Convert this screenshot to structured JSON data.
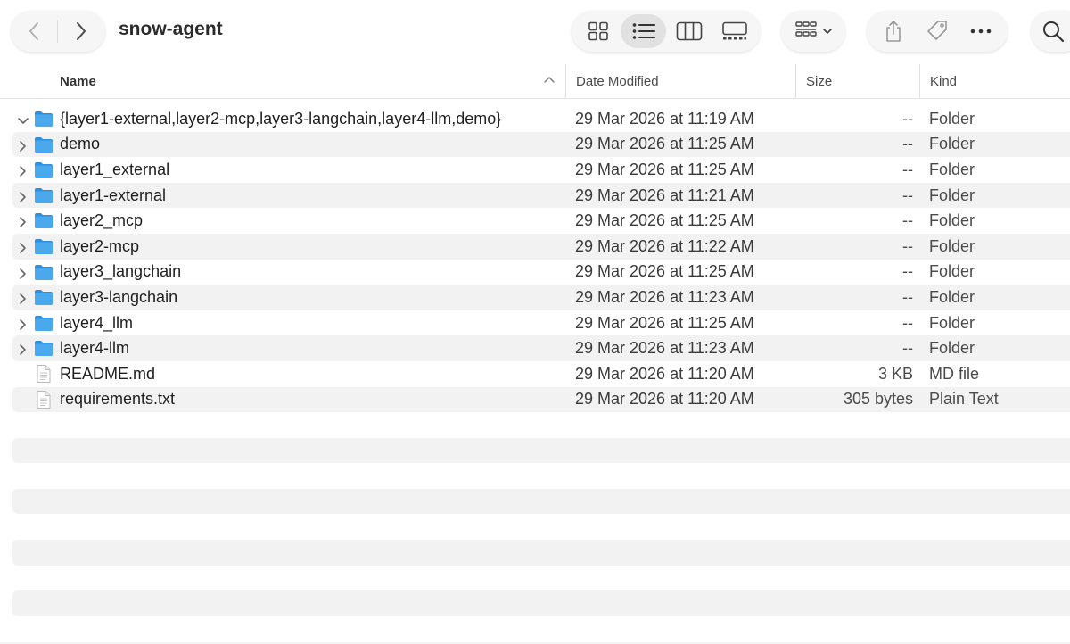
{
  "window": {
    "title": "snow-agent"
  },
  "toolbar": {
    "back_icon": "chevron-left-icon",
    "forward_icon": "chevron-right-icon",
    "view_modes": [
      "icon-view",
      "list-view",
      "column-view",
      "gallery-view"
    ],
    "active_view": "list-view"
  },
  "columns": {
    "name": "Name",
    "date": "Date Modified",
    "size": "Size",
    "kind": "Kind"
  },
  "files": [
    {
      "name": "{layer1-external,layer2-mcp,layer3-langchain,layer4-llm,demo}",
      "date": "29 Mar 2026 at 11:19 AM",
      "size": "--",
      "kind": "Folder",
      "type": "folder",
      "expanded": true
    },
    {
      "name": "demo",
      "date": "29 Mar 2026 at 11:25 AM",
      "size": "--",
      "kind": "Folder",
      "type": "folder",
      "expanded": false
    },
    {
      "name": "layer1_external",
      "date": "29 Mar 2026 at 11:25 AM",
      "size": "--",
      "kind": "Folder",
      "type": "folder",
      "expanded": false
    },
    {
      "name": "layer1-external",
      "date": "29 Mar 2026 at 11:21 AM",
      "size": "--",
      "kind": "Folder",
      "type": "folder",
      "expanded": false
    },
    {
      "name": "layer2_mcp",
      "date": "29 Mar 2026 at 11:25 AM",
      "size": "--",
      "kind": "Folder",
      "type": "folder",
      "expanded": false
    },
    {
      "name": "layer2-mcp",
      "date": "29 Mar 2026 at 11:22 AM",
      "size": "--",
      "kind": "Folder",
      "type": "folder",
      "expanded": false
    },
    {
      "name": "layer3_langchain",
      "date": "29 Mar 2026 at 11:25 AM",
      "size": "--",
      "kind": "Folder",
      "type": "folder",
      "expanded": false
    },
    {
      "name": "layer3-langchain",
      "date": "29 Mar 2026 at 11:23 AM",
      "size": "--",
      "kind": "Folder",
      "type": "folder",
      "expanded": false
    },
    {
      "name": "layer4_llm",
      "date": "29 Mar 2026 at 11:25 AM",
      "size": "--",
      "kind": "Folder",
      "type": "folder",
      "expanded": false
    },
    {
      "name": "layer4-llm",
      "date": "29 Mar 2026 at 11:23 AM",
      "size": "--",
      "kind": "Folder",
      "type": "folder",
      "expanded": false
    },
    {
      "name": "README.md",
      "date": "29 Mar 2026 at 11:20 AM",
      "size": "3 KB",
      "kind": "MD file",
      "type": "file"
    },
    {
      "name": "requirements.txt",
      "date": "29 Mar 2026 at 11:20 AM",
      "size": "305 bytes",
      "kind": "Plain Text",
      "type": "file"
    }
  ],
  "colors": {
    "folder": "#4aa8ec",
    "folder_dark": "#2f8fdc",
    "stripe": "#f2f2f2"
  }
}
